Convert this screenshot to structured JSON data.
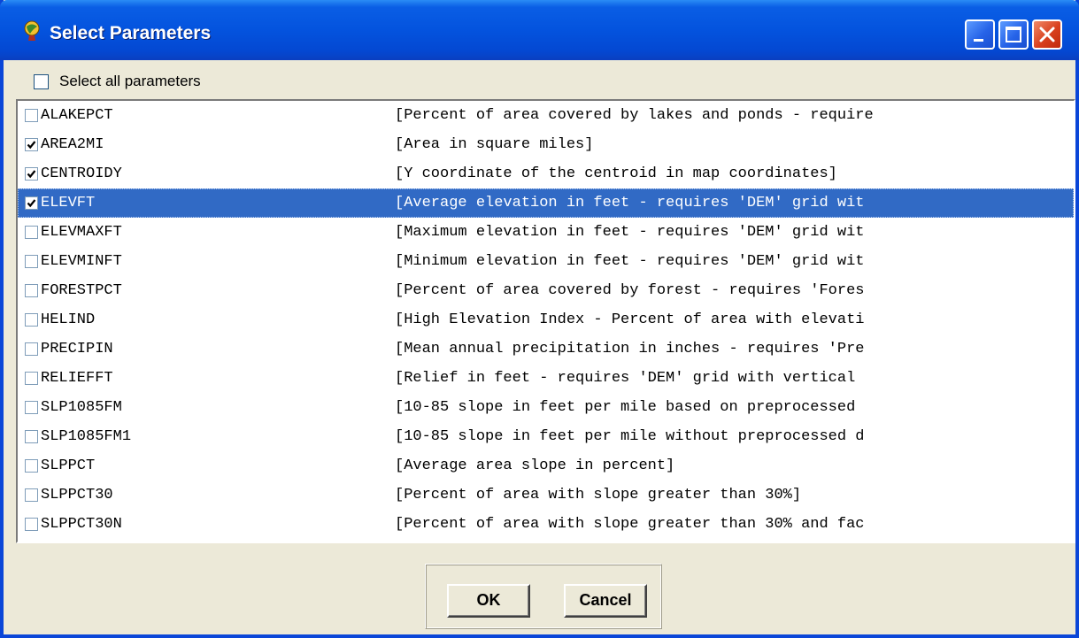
{
  "window": {
    "title": "Select Parameters"
  },
  "select_all": {
    "label": "Select all parameters",
    "checked": false
  },
  "parameters": [
    {
      "code": "ALAKEPCT",
      "description": "[Percent of area covered by lakes and ponds - require",
      "checked": false,
      "selected": false
    },
    {
      "code": "AREA2MI",
      "description": "[Area in square miles]",
      "checked": true,
      "selected": false
    },
    {
      "code": "CENTROIDY",
      "description": "[Y coordinate of the centroid in map coordinates]",
      "checked": true,
      "selected": false
    },
    {
      "code": "ELEVFT",
      "description": "[Average elevation in feet - requires 'DEM' grid wit",
      "checked": true,
      "selected": true
    },
    {
      "code": "ELEVMAXFT",
      "description": "[Maximum elevation in feet - requires 'DEM' grid wit",
      "checked": false,
      "selected": false
    },
    {
      "code": "ELEVMINFT",
      "description": "[Minimum elevation in feet - requires 'DEM' grid wit",
      "checked": false,
      "selected": false
    },
    {
      "code": "FORESTPCT",
      "description": "[Percent of area covered by forest - requires 'Fores",
      "checked": false,
      "selected": false
    },
    {
      "code": "HELIND",
      "description": "[High Elevation Index - Percent of area with elevati",
      "checked": false,
      "selected": false
    },
    {
      "code": "PRECIPIN",
      "description": "[Mean annual precipitation in inches - requires 'Pre",
      "checked": false,
      "selected": false
    },
    {
      "code": "RELIEFFT",
      "description": "[Relief in feet - requires 'DEM' grid with vertical",
      "checked": false,
      "selected": false
    },
    {
      "code": "SLP1085FM",
      "description": "[10-85 slope in feet per mile based on preprocessed",
      "checked": false,
      "selected": false
    },
    {
      "code": "SLP1085FM1",
      "description": "[10-85 slope in feet per mile without preprocessed d",
      "checked": false,
      "selected": false
    },
    {
      "code": "SLPPCT",
      "description": "[Average area slope in percent]",
      "checked": false,
      "selected": false
    },
    {
      "code": "SLPPCT30",
      "description": "[Percent of area with slope greater than 30%]",
      "checked": false,
      "selected": false
    },
    {
      "code": "SLPPCT30N",
      "description": "[Percent of area with slope greater than 30% and fac",
      "checked": false,
      "selected": false
    }
  ],
  "buttons": {
    "ok": "OK",
    "cancel": "Cancel"
  },
  "colors": {
    "titlebar": "#0453de",
    "selection": "#316ac5",
    "dialog_face": "#ece9d8"
  }
}
